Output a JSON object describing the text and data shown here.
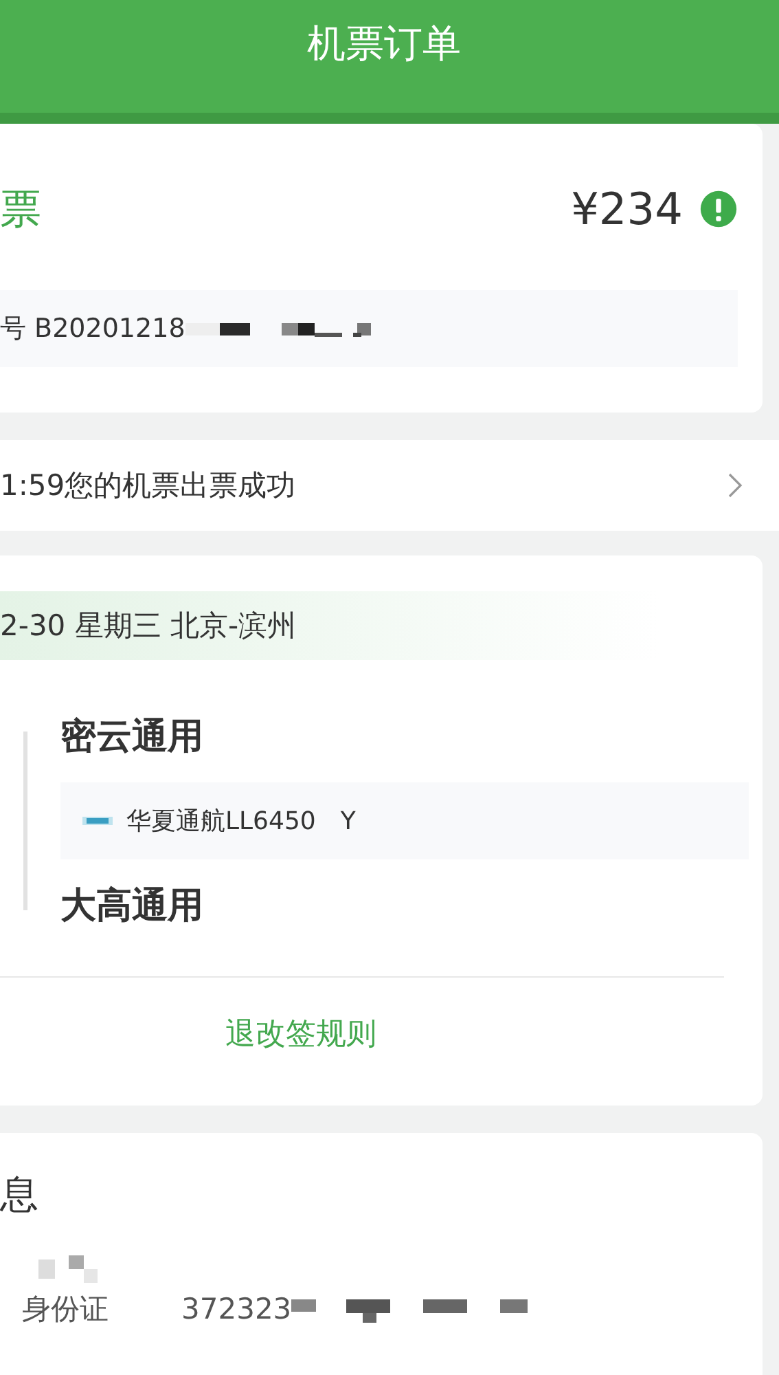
{
  "header": {
    "title": "机票订单"
  },
  "order_card": {
    "title": "票",
    "price": "¥234",
    "order_no": "号 B20201218"
  },
  "status_row": {
    "text": "1:59您的机票出票成功"
  },
  "flight_card": {
    "date_route": "2-30 星期三 北京-滨州",
    "departure": "密云通用",
    "flight": "华夏通航LL6450",
    "cabin": "Y",
    "arrival": "大高通用",
    "rules_link": "退改签规则"
  },
  "passenger_card": {
    "title": "息",
    "fields": [
      {
        "label": "身份证",
        "value": "372323"
      }
    ]
  }
}
